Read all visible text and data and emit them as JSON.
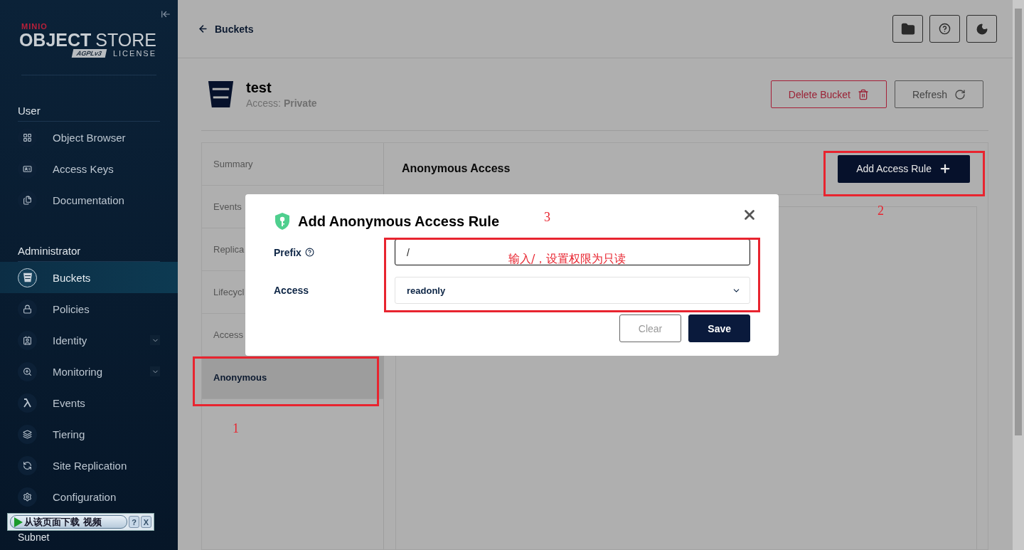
{
  "sidebar": {
    "logo": {
      "brand": "MINIO",
      "product_bold": "OBJECT",
      "product_light": "STORE",
      "badge": "AGPLv3",
      "license": "LICENSE"
    },
    "sections": [
      {
        "title": "User",
        "items": [
          {
            "label": "Object Browser",
            "selected": false,
            "expandable": false
          },
          {
            "label": "Access Keys",
            "selected": false,
            "expandable": false
          },
          {
            "label": "Documentation",
            "selected": false,
            "expandable": false
          }
        ]
      },
      {
        "title": "Administrator",
        "items": [
          {
            "label": "Buckets",
            "selected": true,
            "expandable": false
          },
          {
            "label": "Policies",
            "selected": false,
            "expandable": false
          },
          {
            "label": "Identity",
            "selected": false,
            "expandable": true
          },
          {
            "label": "Monitoring",
            "selected": false,
            "expandable": true
          },
          {
            "label": "Events",
            "selected": false,
            "expandable": false
          },
          {
            "label": "Tiering",
            "selected": false,
            "expandable": false
          },
          {
            "label": "Site Replication",
            "selected": false,
            "expandable": false
          },
          {
            "label": "Configuration",
            "selected": false,
            "expandable": false
          }
        ]
      }
    ],
    "footer_section": "Subnet"
  },
  "header": {
    "back_link": "Buckets"
  },
  "bucket": {
    "name": "test",
    "access_label": "Access:",
    "access_value": "Private",
    "buttons": [
      {
        "label": "Delete Bucket",
        "kind": "danger"
      },
      {
        "label": "Refresh",
        "kind": "refresh"
      }
    ]
  },
  "tabs": [
    {
      "label": "Summary",
      "selected": false
    },
    {
      "label": "Events",
      "selected": false
    },
    {
      "label": "Replica",
      "selected": false
    },
    {
      "label": "Lifecycl",
      "selected": false
    },
    {
      "label": "Access",
      "selected": false
    },
    {
      "label": "Anonymous",
      "selected": true
    }
  ],
  "panel": {
    "title": "Anonymous Access",
    "add_button": "Add Access Rule"
  },
  "modal": {
    "title": "Add Anonymous Access Rule",
    "fields": [
      {
        "label": "Prefix",
        "kind": "input",
        "help": true,
        "value": "/"
      },
      {
        "label": "Access",
        "kind": "select",
        "value": "readonly"
      }
    ],
    "buttons": [
      {
        "label": "Clear",
        "kind": "secondary",
        "disabled": true
      },
      {
        "label": "Save",
        "kind": "primary",
        "disabled": false
      }
    ]
  },
  "annotations": [
    {
      "number": "1"
    },
    {
      "number": "2"
    },
    {
      "number": "3"
    }
  ],
  "annotation_note": "输入/，设置权限为只读",
  "download_bar": {
    "label": "从该页面下载 视频",
    "help": "?",
    "close": "X"
  }
}
